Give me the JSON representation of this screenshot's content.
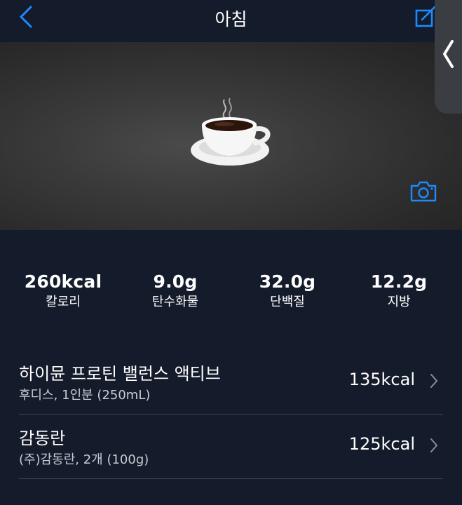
{
  "header": {
    "title": "아침"
  },
  "summary": {
    "calories": {
      "value": "260kcal",
      "label": "칼로리"
    },
    "carbs": {
      "value": "9.0g",
      "label": "탄수화물"
    },
    "protein": {
      "value": "32.0g",
      "label": "단백질"
    },
    "fat": {
      "value": "12.2g",
      "label": "지방"
    }
  },
  "foods": [
    {
      "name": "하이뮨 프로틴 밸런스 액티브",
      "detail": "후디스, 1인분 (250mL)",
      "kcal": "135kcal"
    },
    {
      "name": "감동란",
      "detail": "(주)감동란, 2개 (100g)",
      "kcal": "125kcal"
    }
  ],
  "icons": {
    "back": "chevron-left-icon",
    "edit": "edit-icon",
    "camera": "camera-icon",
    "side": "chevron-left-icon",
    "photo": "coffee-cup-icon"
  },
  "colors": {
    "accent": "#1a8cff",
    "background": "#141b2b",
    "photo_bg": "#333333",
    "divider": "#3c4352"
  }
}
